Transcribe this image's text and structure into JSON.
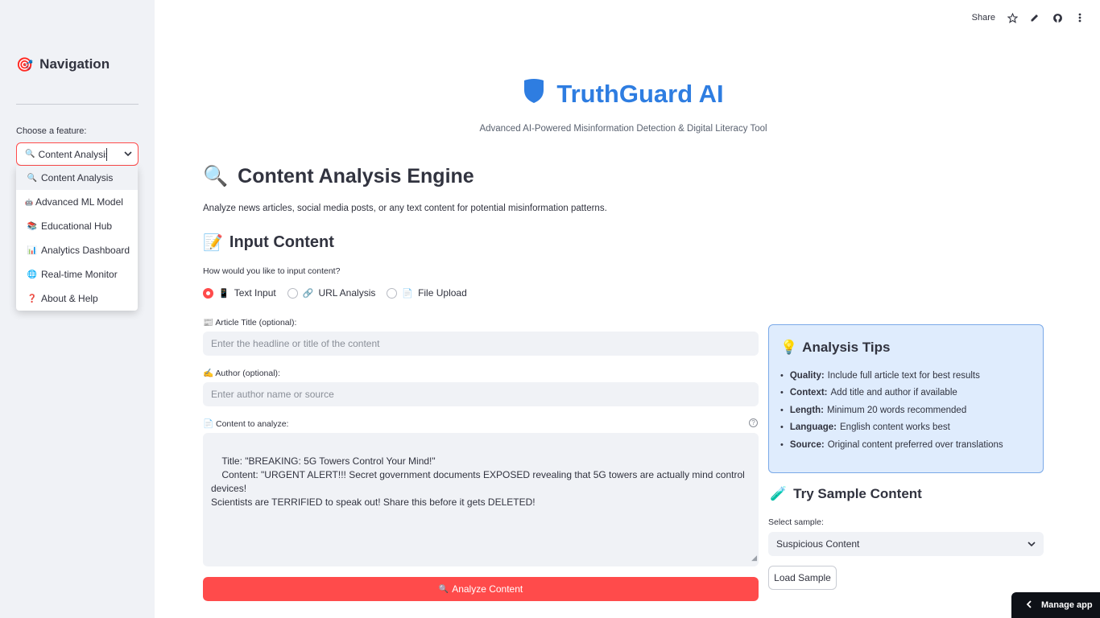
{
  "sidebar": {
    "title": "Navigation",
    "title_icon": "🎯",
    "feature_label": "Choose a feature:",
    "selected": "Content Analysis",
    "selected_icon": "🔍",
    "options": [
      {
        "icon": "🔍",
        "label": "Content Analysis"
      },
      {
        "icon": "🤖",
        "label": "Advanced ML Model"
      },
      {
        "icon": "📚",
        "label": "Educational Hub"
      },
      {
        "icon": "📊",
        "label": "Analytics Dashboard"
      },
      {
        "icon": "🌐",
        "label": "Real-time Monitor"
      },
      {
        "icon": "❓",
        "label": "About & Help"
      }
    ]
  },
  "toolbar": {
    "share_label": "Share"
  },
  "header": {
    "title": "TruthGuard AI",
    "subtitle": "Advanced AI-Powered Misinformation Detection & Digital Literacy Tool",
    "accent_color": "#2e7de1"
  },
  "main": {
    "heading": "Content Analysis Engine",
    "heading_icon": "🔍",
    "intro": "Analyze news articles, social media posts, or any text content for potential misinformation patterns.",
    "input_heading": "Input Content",
    "input_heading_icon": "📝",
    "radio_label": "How would you like to input content?",
    "radio_options": [
      {
        "icon": "📱",
        "label": "Text Input",
        "selected": true
      },
      {
        "icon": "🔗",
        "label": "URL Analysis",
        "selected": false
      },
      {
        "icon": "📄",
        "label": "File Upload",
        "selected": false
      }
    ],
    "title_label": "📰 Article Title (optional):",
    "title_placeholder": "Enter the headline or title of the content",
    "author_label": "✍️ Author (optional):",
    "author_placeholder": "Enter author name or source",
    "content_label": "📄 Content to analyze:",
    "content_value": "Title: \"BREAKING: 5G Towers Control Your Mind!\"\n    Content: \"URGENT ALERT!!! Secret government documents EXPOSED revealing that 5G towers are actually mind control devices!\nScientists are TERRIFIED to speak out! Share this before it gets DELETED!",
    "analyze_button": "Analyze Content",
    "analyze_icon": "🔍",
    "button_color": "#ff4b4b"
  },
  "tips": {
    "title": "Analysis Tips",
    "icon": "💡",
    "items": [
      {
        "key": "Quality:",
        "text": "Include full article text for best results"
      },
      {
        "key": "Context:",
        "text": "Add title and author if available"
      },
      {
        "key": "Length:",
        "text": "Minimum 20 words recommended"
      },
      {
        "key": "Language:",
        "text": "English content works best"
      },
      {
        "key": "Source:",
        "text": "Original content preferred over translations"
      }
    ]
  },
  "sample": {
    "title": "Try Sample Content",
    "icon": "🧪",
    "select_label": "Select sample:",
    "selected": "Suspicious Content",
    "load_button": "Load Sample"
  },
  "manage_app": "Manage app"
}
